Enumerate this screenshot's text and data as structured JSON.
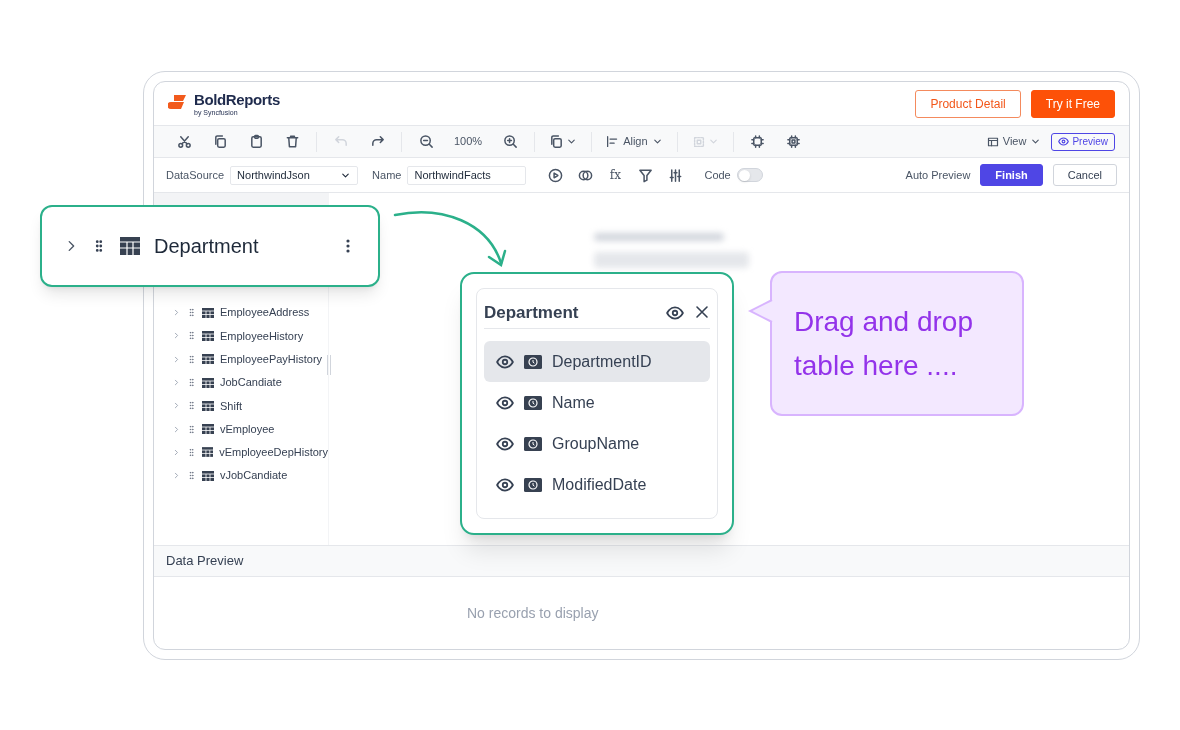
{
  "header": {
    "logo_title": "BoldReports",
    "logo_subtitle": "by Syncfusion",
    "buttons": [
      {
        "label": "Product Detail",
        "kind": "outline"
      },
      {
        "label": "Try it Free",
        "kind": "solid"
      }
    ]
  },
  "toolbar": {
    "groups": [
      [
        {
          "kind": "cut",
          "disabled": false
        },
        {
          "kind": "copy",
          "disabled": false
        },
        {
          "kind": "paste",
          "disabled": false
        },
        {
          "kind": "delete",
          "disabled": false
        }
      ],
      [
        {
          "kind": "undo",
          "disabled": true
        },
        {
          "kind": "redo",
          "disabled": false
        }
      ],
      [
        {
          "kind": "zoom-out",
          "disabled": false
        },
        {
          "kind": "zoom-level",
          "disabled": false,
          "label": "100%"
        },
        {
          "kind": "zoom-in",
          "disabled": false
        }
      ],
      [
        {
          "kind": "copy-menu",
          "disabled": false
        }
      ],
      [
        {
          "kind": "align",
          "disabled": false,
          "label": "Align"
        }
      ],
      [
        {
          "kind": "select-menu",
          "disabled": true
        }
      ],
      [
        {
          "kind": "chip",
          "disabled": false
        },
        {
          "kind": "chip-alt",
          "disabled": false
        }
      ]
    ],
    "view": "View",
    "preview": "Preview"
  },
  "query_bar": {
    "datasource_label": "DataSource",
    "datasource": "NorthwindJson",
    "name_label": "Name",
    "name": "NorthwindFacts",
    "tools": [
      {
        "kind": "run"
      },
      {
        "kind": "join"
      },
      {
        "kind": "formula",
        "label": "fx"
      },
      {
        "kind": "filter"
      },
      {
        "kind": "sliders"
      }
    ],
    "code_label": "Code",
    "code_on": false,
    "auto_preview": "Auto Preview",
    "buttons": [
      {
        "label": "Finish",
        "kind": "primary"
      },
      {
        "label": "Cancel",
        "kind": "secondary"
      }
    ]
  },
  "tables": [
    {
      "label": "EmployeeAddress"
    },
    {
      "label": "EmployeeHistory"
    },
    {
      "label": "EmployeePayHistory"
    },
    {
      "label": "JobCandiate"
    },
    {
      "label": "Shift"
    },
    {
      "label": "vEmployee"
    },
    {
      "label": "vEmployeeDepHistory"
    },
    {
      "label": "vJobCandiate"
    }
  ],
  "callout": {
    "label": "Department"
  },
  "field_card": {
    "title": "Department",
    "fields": [
      {
        "name": "DepartmentID",
        "selected": true
      },
      {
        "name": "Name",
        "selected": false
      },
      {
        "name": "GroupName",
        "selected": false
      },
      {
        "name": "ModifiedDate",
        "selected": false
      }
    ]
  },
  "hint": "Drag and drop table here ....",
  "data_preview": {
    "title": "Data Preview",
    "empty": "No records to display"
  }
}
